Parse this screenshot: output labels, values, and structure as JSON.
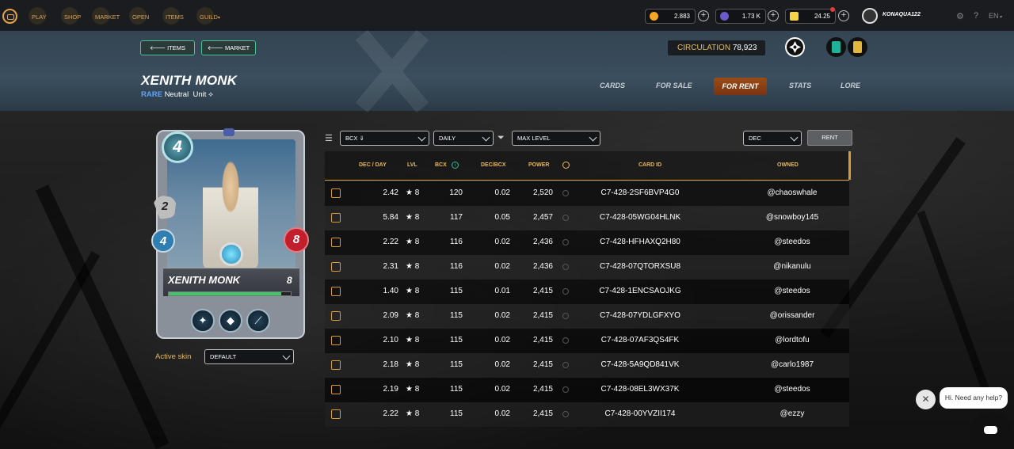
{
  "nav": {
    "items": [
      {
        "label": "PLAY",
        "icon": "play-icon"
      },
      {
        "label": "SHOP",
        "icon": "shop-icon"
      },
      {
        "label": "MARKET",
        "icon": "market-icon"
      },
      {
        "label": "OPEN",
        "icon": "open-packs-icon"
      },
      {
        "label": "ITEMS",
        "icon": "items-icon"
      },
      {
        "label": "GUILD",
        "icon": "guild-icon"
      }
    ],
    "balances": [
      {
        "value": "2.883",
        "icon": "coin-icon",
        "color": "#f5a623"
      },
      {
        "value": "1.73 K",
        "icon": "credits-icon",
        "color": "#6a5acd"
      },
      {
        "value": "24.25",
        "icon": "voucher-icon",
        "color": "#f5d547"
      }
    ],
    "username": "KONAQUA122",
    "language": "EN"
  },
  "header": {
    "back_items": "ITEMS",
    "back_market": "MARKET",
    "circulation_label": "CIRCULATION",
    "circulation_value": "78,923",
    "card_name": "XENITH MONK",
    "rarity": "RARE",
    "splinter": "Neutral",
    "type": "Unit",
    "tabs": [
      "CARDS",
      "FOR SALE",
      "FOR RENT",
      "STATS",
      "LORE"
    ],
    "active_tab": "FOR RENT"
  },
  "card": {
    "mana": "4",
    "attack": "2",
    "speed": "4",
    "health": "8",
    "name": "XENITH MONK",
    "level": "8",
    "active_skin_label": "Active skin",
    "skin_value": "DEFAULT"
  },
  "filters": {
    "sort": "BCX ⇓",
    "period": "DAILY",
    "level": "MAX LEVEL",
    "currency": "DEC",
    "rent_button": "RENT"
  },
  "table": {
    "headers": [
      "DEC / DAY",
      "LVL",
      "BCX",
      "DEC/BCX",
      "POWER",
      "",
      "CARD ID",
      "OWNED"
    ],
    "rows": [
      {
        "dec": "2.42",
        "lvl": "★ 8",
        "bcx": "120",
        "decbcx": "0.02",
        "power": "2,520",
        "id": "C7-428-2SF6BVP4G0",
        "owner": "@chaoswhale"
      },
      {
        "dec": "5.84",
        "lvl": "★ 8",
        "bcx": "117",
        "decbcx": "0.05",
        "power": "2,457",
        "id": "C7-428-05WG04HLNK",
        "owner": "@snowboy145"
      },
      {
        "dec": "2.22",
        "lvl": "★ 8",
        "bcx": "116",
        "decbcx": "0.02",
        "power": "2,436",
        "id": "C7-428-HFHAXQ2H80",
        "owner": "@steedos"
      },
      {
        "dec": "2.31",
        "lvl": "★ 8",
        "bcx": "116",
        "decbcx": "0.02",
        "power": "2,436",
        "id": "C7-428-07QTORXSU8",
        "owner": "@nikanulu"
      },
      {
        "dec": "1.40",
        "lvl": "★ 8",
        "bcx": "115",
        "decbcx": "0.01",
        "power": "2,415",
        "id": "C7-428-1ENCSAOJKG",
        "owner": "@steedos"
      },
      {
        "dec": "2.09",
        "lvl": "★ 8",
        "bcx": "115",
        "decbcx": "0.02",
        "power": "2,415",
        "id": "C7-428-07YDLGFXYO",
        "owner": "@orissander"
      },
      {
        "dec": "2.10",
        "lvl": "★ 8",
        "bcx": "115",
        "decbcx": "0.02",
        "power": "2,415",
        "id": "C7-428-07AF3QS4FK",
        "owner": "@lordtofu"
      },
      {
        "dec": "2.18",
        "lvl": "★ 8",
        "bcx": "115",
        "decbcx": "0.02",
        "power": "2,415",
        "id": "C7-428-5A9QD841VK",
        "owner": "@carlo1987"
      },
      {
        "dec": "2.19",
        "lvl": "★ 8",
        "bcx": "115",
        "decbcx": "0.02",
        "power": "2,415",
        "id": "C7-428-08EL3WX37K",
        "owner": "@steedos"
      },
      {
        "dec": "2.22",
        "lvl": "★ 8",
        "bcx": "115",
        "decbcx": "0.02",
        "power": "2,415",
        "id": "C7-428-00YVZII174",
        "owner": "@ezzy"
      }
    ]
  },
  "chat": {
    "bubble": "Hi. Need any help?",
    "close": "✕"
  }
}
